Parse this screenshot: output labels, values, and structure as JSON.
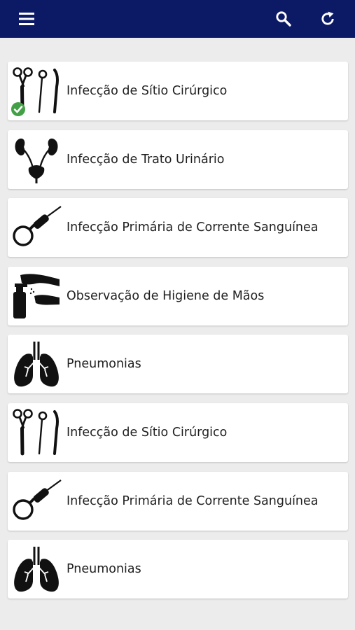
{
  "toolbar": {
    "menu_icon": "menu-icon",
    "search_icon": "search-icon",
    "refresh_icon": "refresh-icon",
    "background_color": "#0c1a66"
  },
  "items": [
    {
      "label": "Infecção de Sítio Cirúrgico",
      "icon": "surgical-instruments-icon",
      "completed": true
    },
    {
      "label": "Infecção de Trato Urinário",
      "icon": "urinary-tract-icon",
      "completed": false
    },
    {
      "label": "Infecção Primária de Corrente Sanguínea",
      "icon": "catheter-icon",
      "completed": false
    },
    {
      "label": "Observação de Higiene de Mãos",
      "icon": "hand-sanitizer-icon",
      "completed": false
    },
    {
      "label": "Pneumonias",
      "icon": "lungs-icon",
      "completed": false
    },
    {
      "label": "Infecção de Sítio Cirúrgico",
      "icon": "surgical-instruments-icon",
      "completed": false
    },
    {
      "label": "Infecção Primária de Corrente Sanguínea",
      "icon": "catheter-icon",
      "completed": false
    },
    {
      "label": "Pneumonias",
      "icon": "lungs-icon",
      "completed": false
    }
  ],
  "status_colors": {
    "completed": "#43a047"
  }
}
